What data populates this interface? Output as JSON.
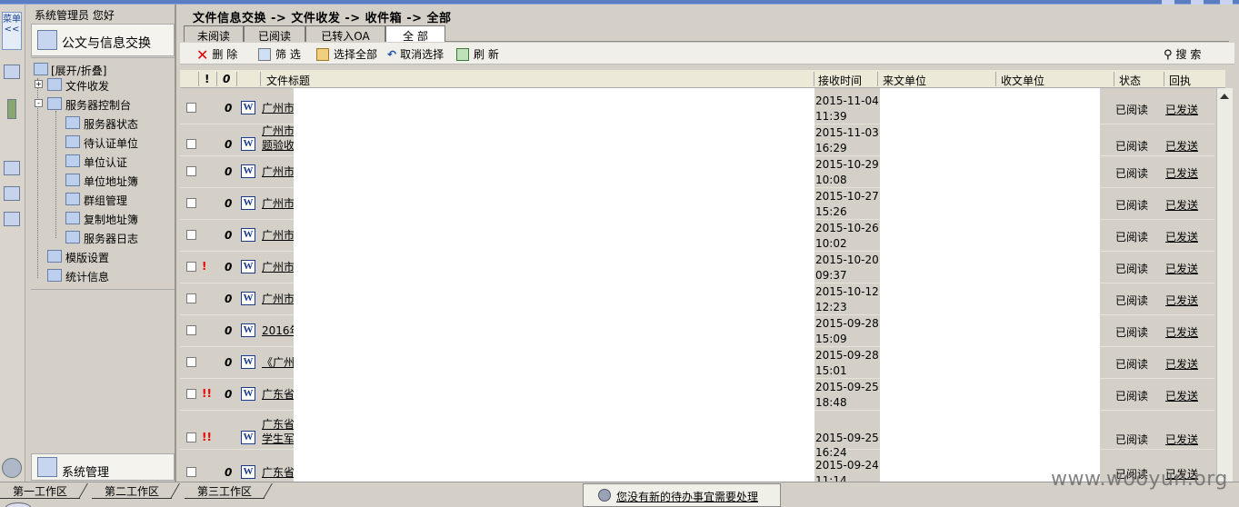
{
  "left_bar": {
    "menu_label": "菜单<<"
  },
  "sidebar": {
    "user_greeting": "系统管理员 您好",
    "module_title": "公文与信息交换",
    "tree": {
      "expand_collapse": "[展开/折叠]",
      "file_inout": "文件收发",
      "server_console": "服务器控制台",
      "server_status": "服务器状态",
      "pending_auth_units": "待认证单位",
      "unit_auth": "单位认证",
      "unit_address_book": "单位地址簿",
      "group_management": "群组管理",
      "copy_address_book": "复制地址簿",
      "server_log": "服务器日志",
      "template_settings": "模版设置",
      "statistics": "统计信息"
    },
    "system_management": "系统管理"
  },
  "main": {
    "breadcrumb": "文件信息交换 -> 文件收发 -> 收件箱 -> 全部",
    "tabs": [
      "未阅读",
      "已阅读",
      "已转入OA",
      "全 部"
    ],
    "active_tab": "全 部",
    "toolbar": {
      "delete": "删 除",
      "filter": "筛 选",
      "select_all": "选择全部",
      "deselect": "取消选择",
      "refresh": "刷 新",
      "search": "搜 索"
    },
    "columns": {
      "importance": "!",
      "attachment": "0",
      "title": "文件标题",
      "received_time": "接收时间",
      "from_unit": "来文单位",
      "to_unit": "收文单位",
      "status": "状态",
      "receipt": "回执"
    },
    "rows": [
      {
        "imp": "",
        "att": "0",
        "title_l1": "广州市",
        "title_l2": "",
        "date": "2015-11-04",
        "time": "11:39",
        "status": "已阅读",
        "receipt": "已发送"
      },
      {
        "imp": "",
        "att": "0",
        "title_l1": "广州市",
        "title_l2": "题验收",
        "date": "2015-11-03",
        "time": "16:29",
        "status": "已阅读",
        "receipt": "已发送"
      },
      {
        "imp": "",
        "att": "0",
        "title_l1": "广州市",
        "title_l2": "",
        "date": "2015-10-29",
        "time": "10:08",
        "status": "已阅读",
        "receipt": "已发送"
      },
      {
        "imp": "",
        "att": "0",
        "title_l1": "广州市",
        "title_l2": "",
        "date": "2015-10-27",
        "time": "15:26",
        "status": "已阅读",
        "receipt": "已发送"
      },
      {
        "imp": "",
        "att": "0",
        "title_l1": "广州市",
        "title_l2": "",
        "date": "2015-10-26",
        "time": "10:02",
        "status": "已阅读",
        "receipt": "已发送"
      },
      {
        "imp": "!",
        "att": "0",
        "title_l1": "广州市",
        "title_l2": "",
        "date": "2015-10-20",
        "time": "09:37",
        "status": "已阅读",
        "receipt": "已发送"
      },
      {
        "imp": "",
        "att": "0",
        "title_l1": "广州市",
        "title_l2": "",
        "date": "2015-10-12",
        "time": "12:23",
        "status": "已阅读",
        "receipt": "已发送"
      },
      {
        "imp": "",
        "att": "0",
        "title_l1": "2016年",
        "title_l2": "",
        "date": "2015-09-28",
        "time": "15:09",
        "status": "已阅读",
        "receipt": "已发送"
      },
      {
        "imp": "",
        "att": "0",
        "title_l1": "《广州",
        "title_l2": "",
        "date": "2015-09-28",
        "time": "15:01",
        "status": "已阅读",
        "receipt": "已发送"
      },
      {
        "imp": "!!",
        "att": "0",
        "title_l1": "广东省",
        "title_l2": "",
        "date": "2015-09-25",
        "time": "18:48",
        "status": "已阅读",
        "receipt": "已发送"
      },
      {
        "imp": "!!",
        "att": "",
        "title_l1": "广东省",
        "title_l2": "学生军",
        "date": "2015-09-25",
        "time": "16:24",
        "status": "已阅读",
        "receipt": "已发送"
      },
      {
        "imp": "",
        "att": "0",
        "title_l1": "广东省",
        "title_l2": "",
        "date": "2015-09-24",
        "time": "11:14",
        "status": "已阅读",
        "receipt": "已发送"
      }
    ]
  },
  "bottom": {
    "work_tabs": [
      "第一工作区",
      "第二工作区",
      "第三工作区"
    ],
    "notice": "您没有新的待办事宜需要处理"
  },
  "watermark": "www.wooyun.org"
}
